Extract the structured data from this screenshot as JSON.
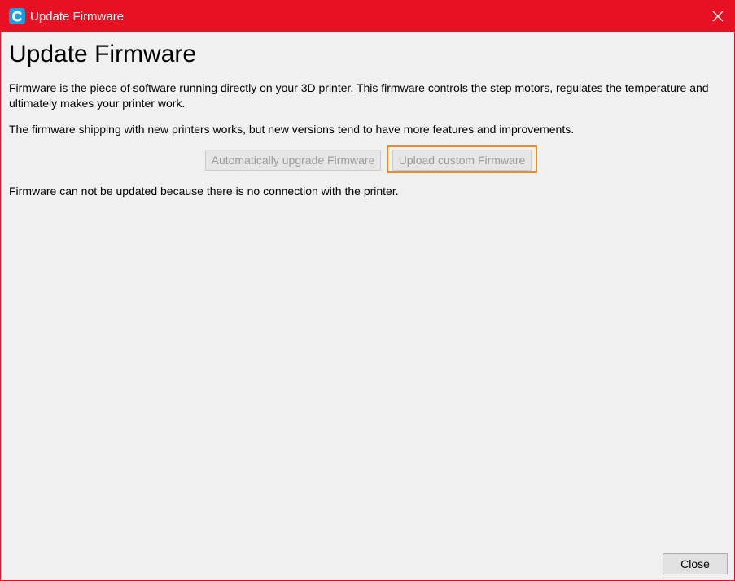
{
  "window": {
    "title": "Update Firmware",
    "app_icon": "cura-c-icon",
    "accent_color": "#e81123",
    "close_icon": "close-icon"
  },
  "main": {
    "heading": "Update Firmware",
    "description": "Firmware is the piece of software running directly on your 3D printer. This firmware controls the step motors, regulates the temperature and ultimately makes your printer work.",
    "note": "The firmware shipping with new printers works, but new versions tend to have more features and improvements.",
    "auto_upgrade_label": "Automatically upgrade Firmware",
    "upload_custom_label": "Upload custom Firmware",
    "status": "Firmware can not be updated because there is no connection with the printer.",
    "focus_color": "#ef8c1a"
  },
  "footer": {
    "close_label": "Close"
  }
}
